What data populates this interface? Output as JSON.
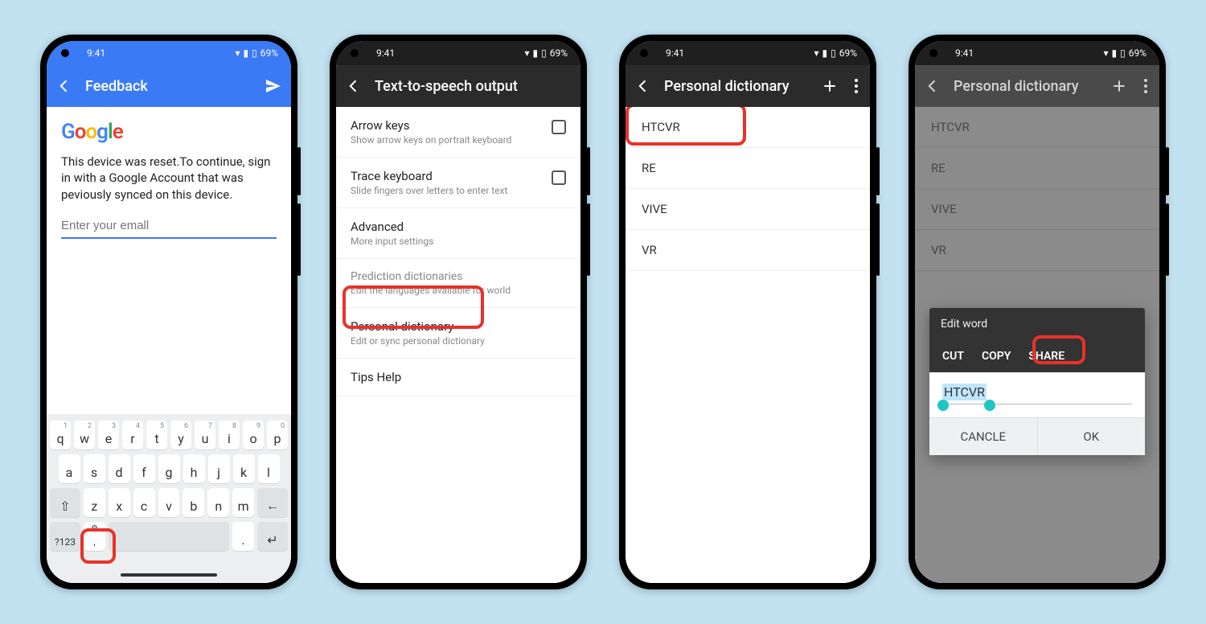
{
  "status": {
    "time": "9:41",
    "battery": "69%"
  },
  "p1": {
    "appbar_title": "Feedback",
    "body_text": "This device was reset.To continue, sign in with a Google Account that was peviously synced on this device.",
    "email_placeholder": "Enter your emall",
    "keyboard": {
      "row1": [
        [
          "q",
          "1"
        ],
        [
          "w",
          "2"
        ],
        [
          "e",
          "3"
        ],
        [
          "r",
          "4"
        ],
        [
          "t",
          "5"
        ],
        [
          "y",
          "6"
        ],
        [
          "u",
          "7"
        ],
        [
          "i",
          "8"
        ],
        [
          "o",
          "9"
        ],
        [
          "p",
          "0"
        ]
      ],
      "row2": [
        "a",
        "s",
        "d",
        "f",
        "g",
        "h",
        "j",
        "k",
        "l"
      ],
      "row3": [
        "z",
        "x",
        "c",
        "v",
        "b",
        "n",
        "m"
      ],
      "sym": "?123"
    }
  },
  "p2": {
    "appbar_title": "Text-to-speech output",
    "items": [
      {
        "t1": "Arrow keys",
        "t2": "Show arrow keys on portrait keyboard",
        "chk": true
      },
      {
        "t1": "Trace keyboard",
        "t2": "Slide fingers over letters to enter text",
        "chk": true
      },
      {
        "t1": "Advanced",
        "t2": "More input settings"
      },
      {
        "section": "Prediction dictionaries",
        "t2": "Edit the languages available for world"
      },
      {
        "t1": "Personal dictionary",
        "t2": "Edit or sync personal dictionary"
      },
      {
        "t1": "Tips Help"
      }
    ]
  },
  "p3": {
    "appbar_title": "Personal dictionary",
    "words": [
      "HTCVR",
      "RE",
      "VIVE",
      "VR"
    ]
  },
  "p4": {
    "appbar_title": "Personal dictionary",
    "words": [
      "HTCVR",
      "RE",
      "VIVE",
      "VR"
    ],
    "dialog": {
      "header": "Edit word",
      "ctx": [
        "CUT",
        "COPY",
        "SHARE"
      ],
      "selected": "HTCVR",
      "cancel": "CANCLE",
      "ok": "OK"
    }
  }
}
